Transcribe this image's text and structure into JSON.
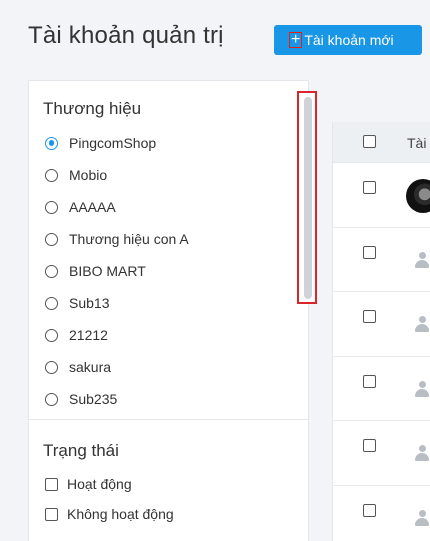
{
  "header": {
    "title": "Tài khoản quản trị",
    "new_button_label": "Tài khoản mới",
    "plus_glyph": "+"
  },
  "filters": {
    "brand": {
      "title": "Thương hiệu",
      "options": [
        "PingcomShop",
        "Mobio",
        "AAAAA",
        "Thương hiệu con A",
        "BIBO MART",
        "Sub13",
        "21212",
        "sakura",
        "Sub235"
      ],
      "selected": "PingcomShop"
    },
    "status": {
      "title": "Trạng thái",
      "options": [
        "Hoạt động",
        "Không hoạt động"
      ]
    }
  },
  "table": {
    "column_label": "Tài",
    "rows": [
      {
        "avatar": "photo"
      },
      {
        "avatar": "user-icon"
      },
      {
        "avatar": "user-icon"
      },
      {
        "avatar": "user-icon"
      },
      {
        "avatar": "user-icon"
      },
      {
        "avatar": "user-icon"
      }
    ]
  },
  "colors": {
    "primary": "#1a96e6",
    "highlight_outline": "#d9262b"
  }
}
